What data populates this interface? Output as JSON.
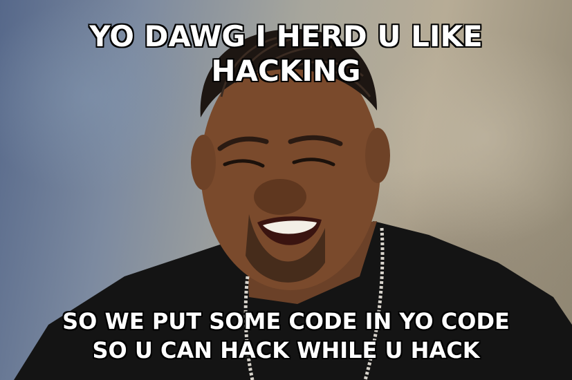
{
  "meme": {
    "top_text": [
      "YO DAWG I HERD U LIKE",
      "HACKING"
    ],
    "bottom_text": [
      "SO WE PUT SOME CODE IN YO CODE",
      "SO U CAN HACK WHILE U HACK"
    ]
  },
  "colors": {
    "caption_fill": "#ffffff",
    "caption_outline": "#000000",
    "shirt": "#141414",
    "skin": "#7a4a2c"
  }
}
